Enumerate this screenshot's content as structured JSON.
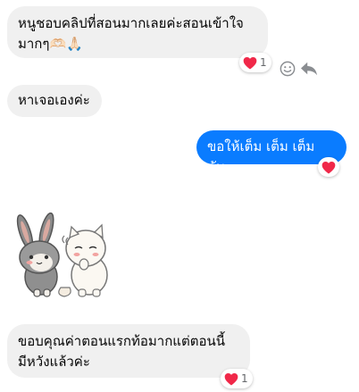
{
  "messages": [
    {
      "id": "m1",
      "direction": "incoming",
      "text": "หนูชอบคลิปที่สอนมากเลยค่ะสอนเข้าใจ\nมากๆ🫶🏻🙏🏻",
      "reaction": {
        "emoji": "heart",
        "count": "1"
      }
    },
    {
      "id": "m2",
      "direction": "incoming",
      "text": "หาเจอเองค่ะ"
    },
    {
      "id": "m3",
      "direction": "outgoing",
      "text": "ขอให้เต็ม เต็ม เต็ม คับ",
      "reaction": {
        "emoji": "heart",
        "count": "1"
      }
    },
    {
      "id": "m4",
      "direction": "incoming",
      "type": "sticker",
      "sticker": "bunny-and-cat-sticker"
    },
    {
      "id": "m5",
      "direction": "incoming",
      "text": "ขอบคุณค่าตอนแรกท้อมากแต่ตอนนี้\nมีหวังแล้วค่ะ",
      "reaction": {
        "emoji": "heart",
        "count": "1"
      }
    }
  ],
  "hover_actions": [
    "smiley-icon",
    "reply-icon"
  ],
  "colors": {
    "incoming_bubble": "#f0f0f0",
    "outgoing_bubble": "#0a7cff",
    "heart": "#f02849"
  }
}
